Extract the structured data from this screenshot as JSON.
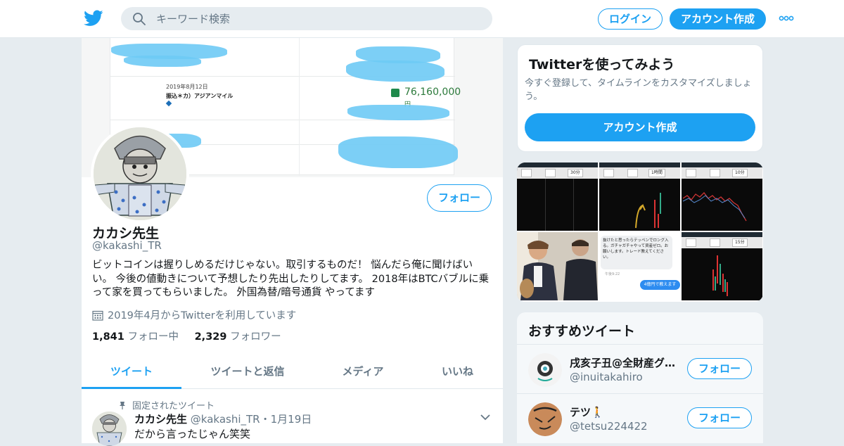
{
  "header": {
    "search_placeholder": "キーワード検索",
    "login_label": "ログイン",
    "signup_label": "アカウント作成"
  },
  "banner": {
    "date": "2019年8月12日",
    "description": "振込＊カ）アジアンマイル",
    "amount": "76,160,000",
    "currency": "円"
  },
  "profile": {
    "display_name": "カカシ先生",
    "handle": "@kakashi_TR",
    "follow_label": "フォロー",
    "bio": "ビットコインは握りしめるだけじゃない。取引するものだ！ 悩んだら俺に聞けばいい。 今後の値動きについて予想したり先出したりしてます。 2018年はBTCバブルに乗って家を買ってもらいました。 外国為替/暗号通貨 やってます",
    "joined": "2019年4月からTwitterを利用しています",
    "following_count": "1,841",
    "following_label": "フォロー中",
    "followers_count": "2,329",
    "followers_label": "フォロワー"
  },
  "tabs": [
    {
      "label": "ツイート",
      "active": true
    },
    {
      "label": "ツイートと返信",
      "active": false
    },
    {
      "label": "メディア",
      "active": false
    },
    {
      "label": "いいね",
      "active": false
    }
  ],
  "pinned_tweet": {
    "pinned_label": "固定されたツイート",
    "author_name": "カカシ先生",
    "author_handle": "@kakashi_TR",
    "separator": "・",
    "date": "1月19日",
    "text": "だから言ったじゃん笑笑"
  },
  "signup_card": {
    "title": "Twitterを使ってみよう",
    "subtitle": "今すぐ登録して、タイムラインをカスタマイズしましょう。",
    "button_label": "アカウント作成"
  },
  "media_grid": {
    "labels": [
      "30分",
      "1時間",
      "10分",
      "15分"
    ],
    "chat_message": "抜けたと思ったらテッペンでロング入る。ガチャガチャやって資産ゼロ。お願いします。トレード教えてください。",
    "chat_reply": "4億円で教えます",
    "chat_time": "午後9:22"
  },
  "recommended": {
    "title": "おすすめツイート",
    "items": [
      {
        "name": "戌亥子丑@全財産グ…",
        "handle": "@inuitakahiro",
        "follow_label": "フォロー"
      },
      {
        "name": "テツ🚶",
        "handle": "@tetsu224422",
        "follow_label": "フォロー"
      }
    ]
  },
  "colors": {
    "accent": "#1da1f2",
    "background": "#e6ecf0",
    "text_secondary": "#657786"
  }
}
